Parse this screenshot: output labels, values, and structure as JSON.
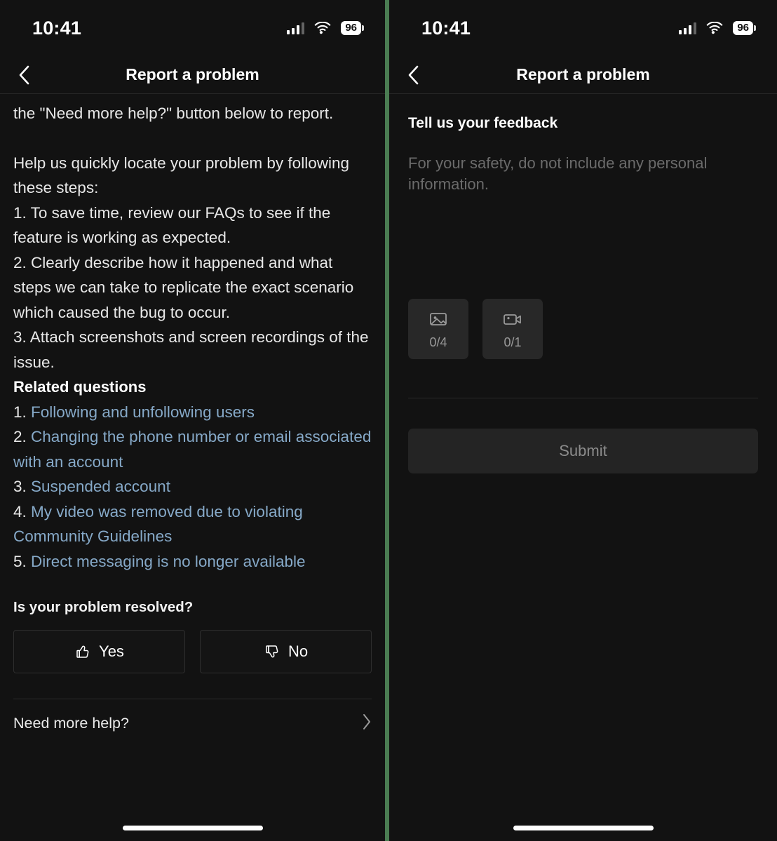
{
  "status_bar": {
    "time": "10:41",
    "battery_level": "96",
    "cellular_icon": "cellular-signal-icon",
    "wifi_icon": "wifi-icon",
    "battery_icon": "battery-icon"
  },
  "nav": {
    "title": "Report a problem",
    "back_icon": "chevron-left-icon"
  },
  "left_screen": {
    "paragraphs": [
      "the \"Need more help?\" button below to report.",
      "Help us quickly locate your problem by following these steps:\n1. To save time, review our FAQs to see if the feature is working as expected.\n2. Clearly describe how it happened and what steps we can take to replicate the exact scenario which caused the bug to occur.\n3. Attach screenshots and screen recordings of the issue."
    ],
    "paragraph_1": "the \"Need more help?\" button below to report.",
    "paragraph_2_intro": "Help us quickly locate your problem by following these steps:",
    "steps": [
      "1. To save time, review our FAQs to see if the feature is working as expected.",
      "2. Clearly describe how it happened and what steps we can take to replicate the exact scenario which caused the bug to occur.",
      "3. Attach screenshots and screen recordings of the issue."
    ],
    "related_questions_heading": "Related questions",
    "related_questions": [
      {
        "number": "1.",
        "text": "Following and unfollowing users"
      },
      {
        "number": "2.",
        "text": "Changing the phone number or email associated with an account"
      },
      {
        "number": "3.",
        "text": "Suspended account"
      },
      {
        "number": "4.",
        "text": "My video was removed due to violating Community Guidelines"
      },
      {
        "number": "5.",
        "text": "Direct messaging is no longer available"
      }
    ],
    "resolved_question": "Is your problem resolved?",
    "yes_label": "Yes",
    "no_label": "No",
    "yes_icon": "thumbs-up-icon",
    "no_icon": "thumbs-down-icon",
    "need_more_help_label": "Need more help?",
    "need_more_help_icon": "chevron-right-icon",
    "link_color": "#86a9c8"
  },
  "right_screen": {
    "feedback_title": "Tell us your feedback",
    "feedback_placeholder": "For your safety, do not include any personal information.",
    "uploads": [
      {
        "icon": "image-upload-icon",
        "count": "0/4"
      },
      {
        "icon": "video-upload-icon",
        "count": "0/1"
      }
    ],
    "submit_label": "Submit",
    "submit_disabled_color": "#8c8c8c"
  },
  "theme": {
    "background": "#121212",
    "divider_green": "#4a7c52",
    "border": "#2b2b2b",
    "text_primary": "#e8e8e8",
    "text_muted": "#6b6b6b"
  }
}
